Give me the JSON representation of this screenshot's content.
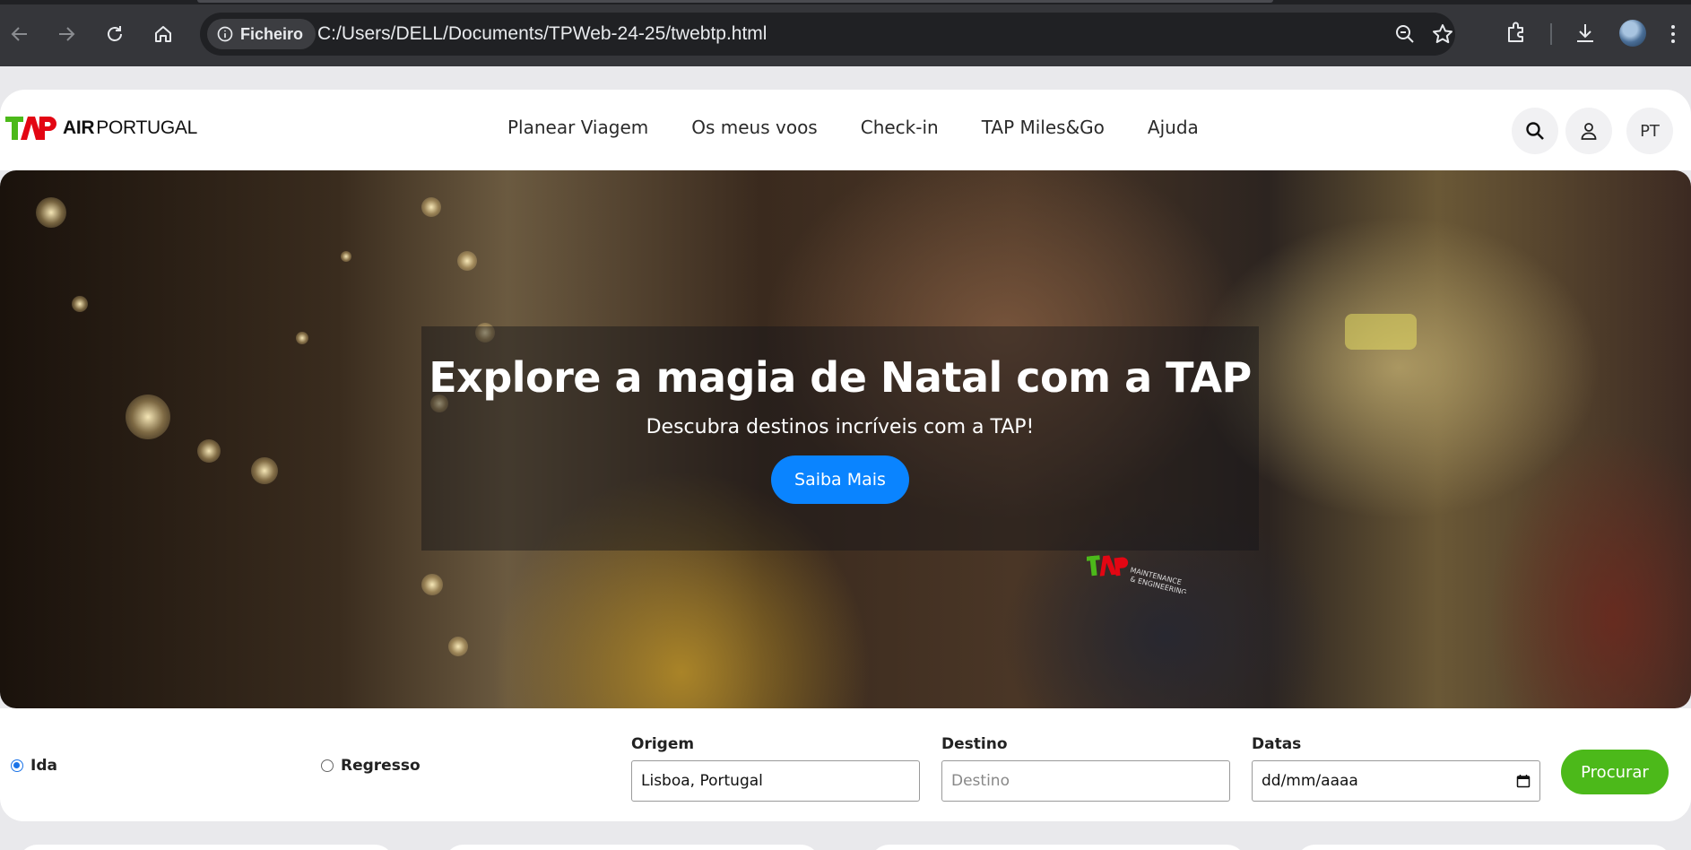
{
  "browser": {
    "location_chip_label": "Ficheiro",
    "url": "C:/Users/DELL/Documents/TPWeb-24-25/twebtp.html",
    "icons": [
      "back-arrow-icon",
      "forward-arrow-icon",
      "reload-icon",
      "home-icon",
      "info-icon",
      "zoom-icon",
      "bookmark-star-icon",
      "extensions-icon",
      "download-icon",
      "profile-avatar"
    ]
  },
  "header": {
    "logo": {
      "mark": "TAP",
      "bold": "AIR",
      "text": "PORTUGAL"
    },
    "menu": [
      "Planear Viagem",
      "Os meus voos",
      "Check-in",
      "TAP Miles&Go",
      "Ajuda"
    ],
    "language": "PT",
    "icons": [
      "search-icon",
      "user-icon"
    ]
  },
  "hero": {
    "title": "Explore a magia de Natal com a TAP",
    "subtitle": "Descubra destinos incríveis com a TAP!",
    "cta": "Saiba Mais"
  },
  "booking": {
    "trip_types": [
      {
        "label": "Ida",
        "selected": true
      },
      {
        "label": "Regresso",
        "selected": false
      }
    ],
    "origin": {
      "label": "Origem",
      "value": "Lisboa, Portugal"
    },
    "destination": {
      "label": "Destino",
      "placeholder": "Destino",
      "value": ""
    },
    "dates": {
      "label": "Datas",
      "placeholder": "dd/mm/aaaa"
    },
    "submit": "Procurar"
  },
  "colors": {
    "brand_green": "#4cb91a",
    "brand_red": "#e30613",
    "cta_blue": "#0a84ff",
    "chrome_dark": "#35363a"
  }
}
